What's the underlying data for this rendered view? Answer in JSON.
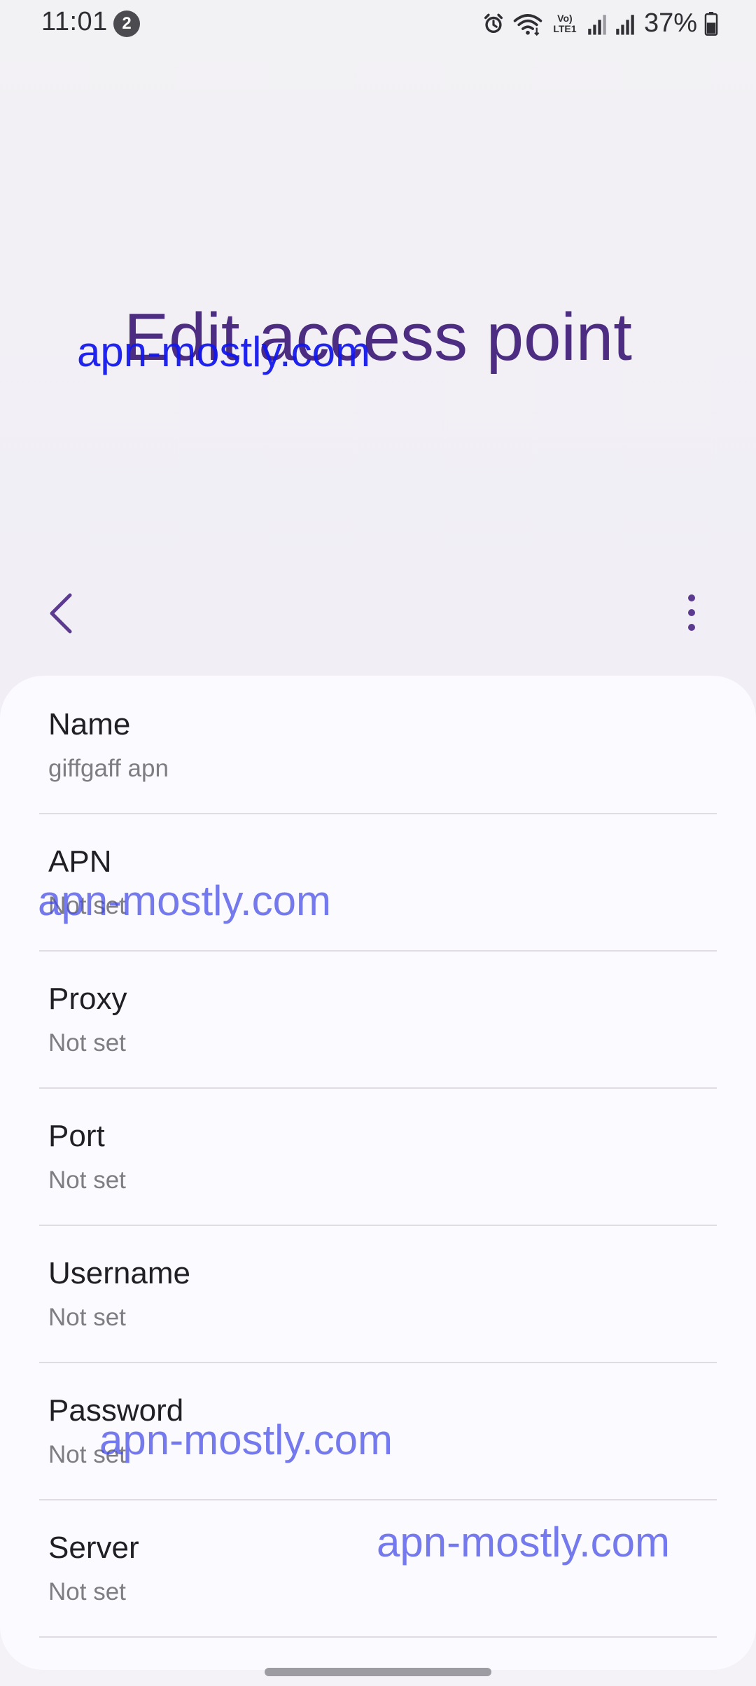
{
  "status_bar": {
    "time": "11:01",
    "notification_count": "2",
    "network_label": "Vo) LTE1",
    "battery_percent": "37%"
  },
  "page": {
    "title": "Edit access point"
  },
  "toolbar": {
    "back_icon": "chevron-left-icon",
    "more_icon": "more-vertical-icon"
  },
  "settings": [
    {
      "label": "Name",
      "value": "giffgaff apn"
    },
    {
      "label": "APN",
      "value": "Not set"
    },
    {
      "label": "Proxy",
      "value": "Not set"
    },
    {
      "label": "Port",
      "value": "Not set"
    },
    {
      "label": "Username",
      "value": "Not set"
    },
    {
      "label": "Password",
      "value": "Not set"
    },
    {
      "label": "Server",
      "value": "Not set"
    }
  ],
  "watermarks": [
    "apn-mostly.com",
    "apn-mostly.com",
    "apn-mostly.com",
    "apn-mostly.com"
  ],
  "colors": {
    "title": "#4c2d82",
    "accent": "#5b3a8f",
    "watermark": "#4046e6"
  }
}
